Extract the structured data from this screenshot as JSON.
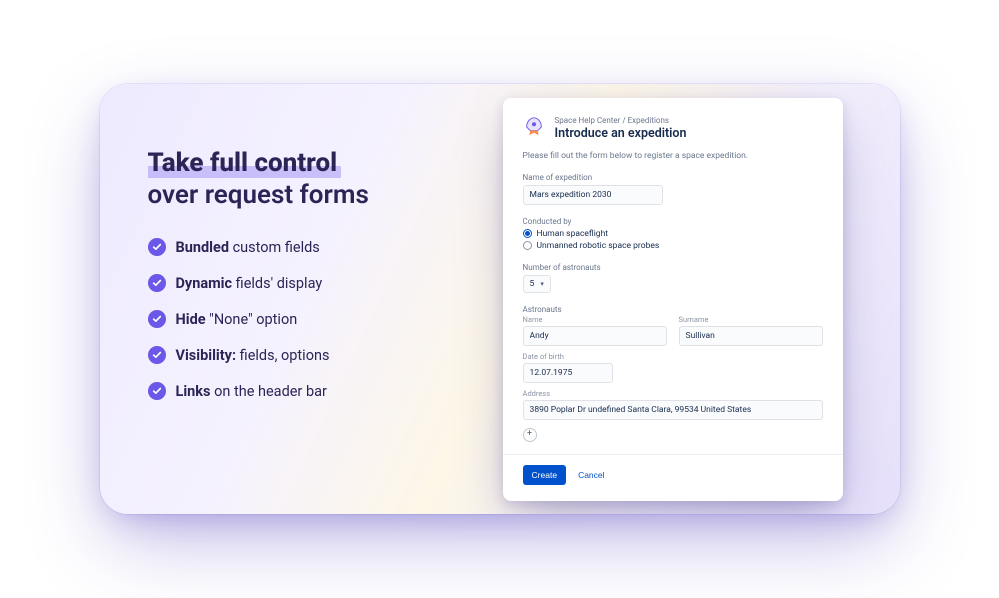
{
  "marketing": {
    "heading_line1": "Take full control",
    "heading_line2": "over request forms",
    "features": [
      {
        "bold": "Bundled",
        "rest": " custom fields"
      },
      {
        "bold": "Dynamic",
        "rest": " fields' display"
      },
      {
        "bold": "Hide",
        "rest": " \"None\" option"
      },
      {
        "bold": "Visibility:",
        "rest": " fields, options"
      },
      {
        "bold": "Links",
        "rest": " on the header bar"
      }
    ]
  },
  "form": {
    "breadcrumb": "Space Help Center / Expeditions",
    "title": "Introduce an expedition",
    "description": "Please fill out the form below to register a space expedition.",
    "name_label": "Name of expedition",
    "name_value": "Mars expedition 2030",
    "conducted_label": "Conducted by",
    "conducted_options": [
      {
        "label": "Human spaceflight",
        "checked": true
      },
      {
        "label": "Unmanned robotic space probes",
        "checked": false
      }
    ],
    "num_label": "Number of astronauts",
    "num_value": "5",
    "astronauts_heading": "Astronauts",
    "name_sublabel": "Name",
    "surname_sublabel": "Surname",
    "name_value_first": "Andy",
    "name_value_last": "Sullivan",
    "dob_label": "Date of birth",
    "dob_value": "12.07.1975",
    "address_label": "Address",
    "address_value": "3890 Poplar Dr undefined Santa Clara, 99534 United States",
    "add_symbol": "+",
    "create_label": "Create",
    "cancel_label": "Cancel"
  }
}
